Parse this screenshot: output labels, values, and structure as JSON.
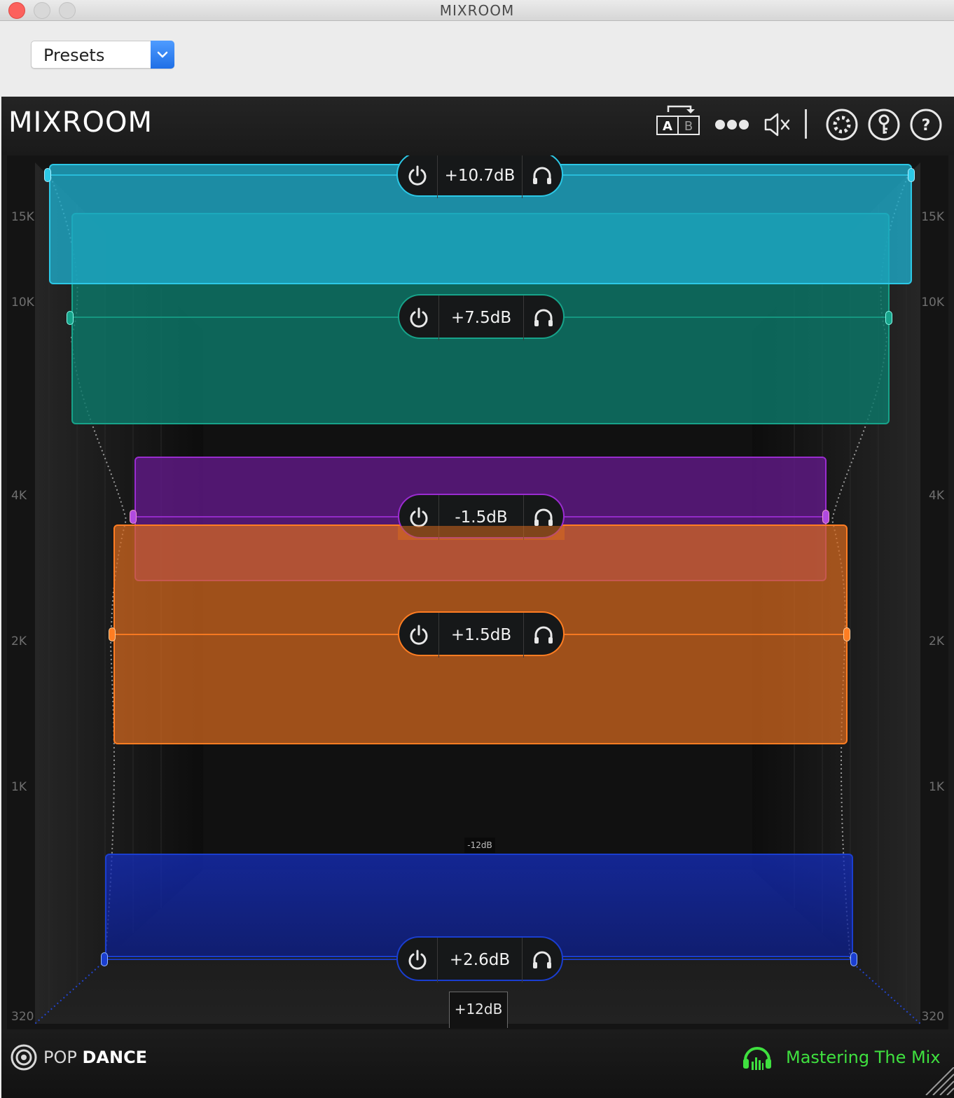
{
  "window": {
    "title": "MIXROOM"
  },
  "host": {
    "presets_label": "Presets"
  },
  "plugin": {
    "logo": "MIXROOM",
    "toolbar": {
      "ab": {
        "a": "A",
        "b": "B"
      },
      "icons": [
        "ab-compare-icon",
        "more-dots-icon",
        "speaker-mute-icon",
        "gear-icon",
        "key-icon",
        "help-icon"
      ]
    },
    "freq_labels": [
      "15K",
      "10K",
      "4K",
      "2K",
      "1K",
      "320"
    ],
    "bands": [
      {
        "name": "band-1",
        "gain": "+10.7dB",
        "color": "#1fb3cf"
      },
      {
        "name": "band-2",
        "gain": "+7.5dB",
        "color": "#0f7f6d"
      },
      {
        "name": "band-3",
        "gain": "-1.5dB",
        "color": "#7a1ea8"
      },
      {
        "name": "band-4",
        "gain": "+1.5dB",
        "color": "#f07a22"
      },
      {
        "name": "band-5",
        "gain": "+2.6dB",
        "color": "#0f2a9a"
      }
    ],
    "scale": {
      "min_label": "-12dB",
      "max_label": "+12dB"
    },
    "footer": {
      "genre_prefix": "POP",
      "genre_name": "DANCE",
      "brand": "Mastering The Mix"
    }
  }
}
